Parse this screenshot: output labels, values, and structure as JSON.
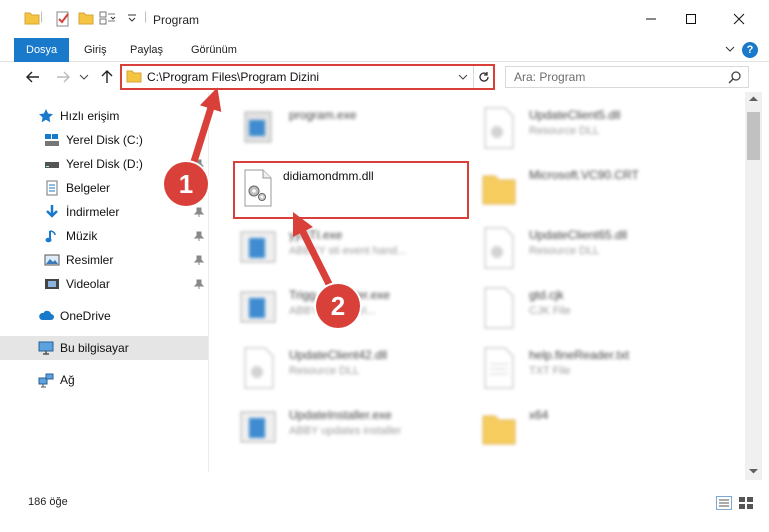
{
  "window": {
    "title": "Program"
  },
  "ribbon": {
    "tabs": [
      {
        "label": "Dosya",
        "active": true
      },
      {
        "label": "Giriş"
      },
      {
        "label": "Paylaş"
      },
      {
        "label": "Görünüm"
      }
    ],
    "help": "?"
  },
  "address": {
    "path": "C:\\Program Files\\Program Dizini"
  },
  "search": {
    "placeholder": "Ara: Program"
  },
  "sidebar": {
    "items": [
      {
        "label": "Hızlı erişim",
        "icon": "star-icon"
      },
      {
        "label": "Yerel Disk (C:)",
        "icon": "drive-icon"
      },
      {
        "label": "Yerel Disk (D:)",
        "icon": "drive-icon"
      },
      {
        "label": "Belgeler",
        "icon": "documents-icon"
      },
      {
        "label": "İndirmeler",
        "icon": "download-icon"
      },
      {
        "label": "Müzik",
        "icon": "music-icon"
      },
      {
        "label": "Resimler",
        "icon": "pictures-icon"
      },
      {
        "label": "Videolar",
        "icon": "videos-icon"
      },
      {
        "label": "OneDrive",
        "icon": "cloud-icon"
      },
      {
        "label": "Bu bilgisayar",
        "icon": "computer-icon",
        "selected": true
      },
      {
        "label": "Ağ",
        "icon": "network-icon"
      }
    ]
  },
  "files": {
    "target": {
      "name": "didiamondmm.dll"
    },
    "items": [
      {
        "name": "program.exe",
        "sub": ""
      },
      {
        "name": "UpdateClient5.dll",
        "sub": "Resource DLL"
      },
      {
        "name": "Microsoft.VC90.CRT",
        "sub": ""
      },
      {
        "name": "yySTI.exe",
        "sub": "ABBYY sti event hand..."
      },
      {
        "name": "UpdateClient65.dll",
        "sub": "Resource DLL"
      },
      {
        "name": "Trigg...Installer.exe",
        "sub": "ABBY...eader tri..."
      },
      {
        "name": "gtd.cjk",
        "sub": "CJK File"
      },
      {
        "name": "UpdateClient42.dll",
        "sub": "Resource DLL"
      },
      {
        "name": "help.fineReader.txt",
        "sub": "TXT File"
      },
      {
        "name": "UpdateInstaller.exe",
        "sub": "ABBY updates installer"
      },
      {
        "name": "x64",
        "sub": ""
      }
    ]
  },
  "status": {
    "count": "186 öğe"
  },
  "annotations": {
    "step1": "1",
    "step2": "2"
  },
  "colors": {
    "accent": "#1979ca",
    "highlight": "#d9403a",
    "folder": "#f5c542"
  }
}
